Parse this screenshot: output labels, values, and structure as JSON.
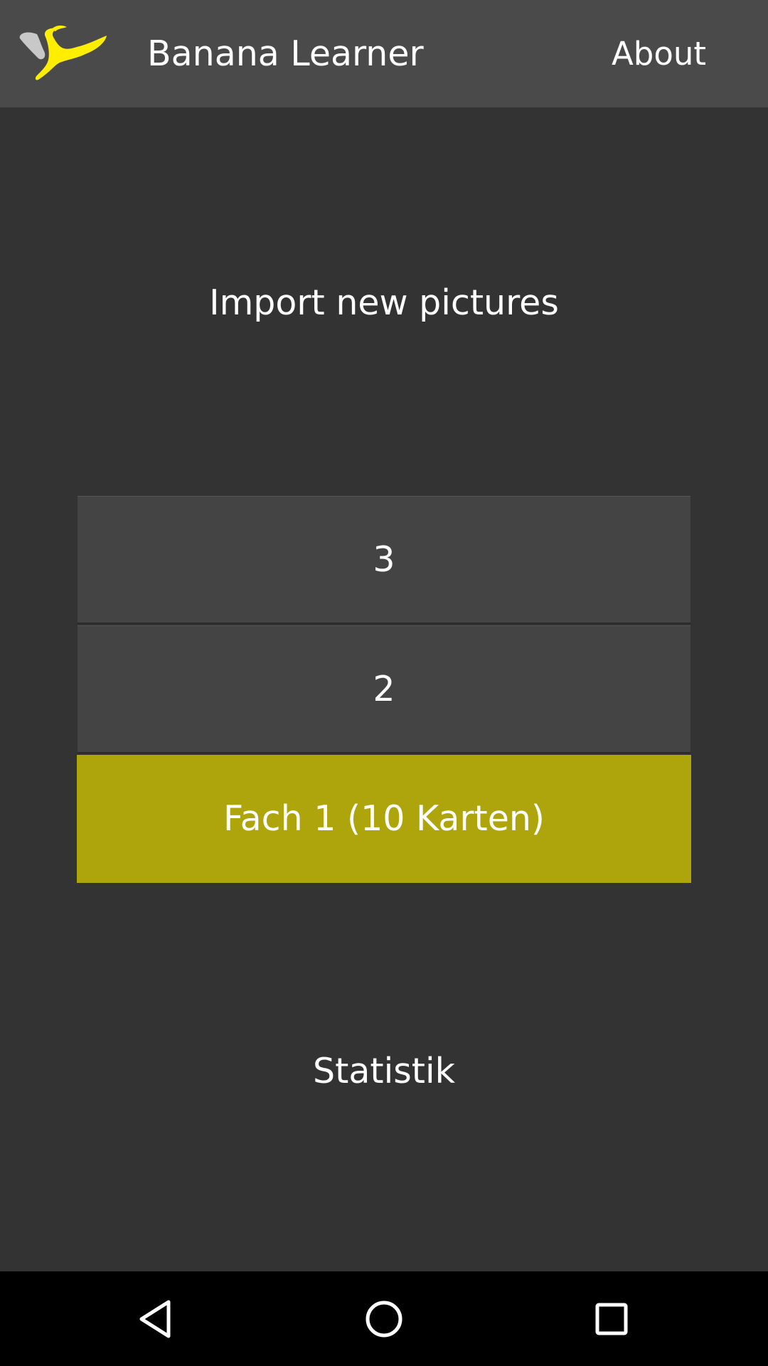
{
  "action_bar": {
    "title": "Banana Learner",
    "about_label": "About",
    "logo_icon": "banana-logo-icon",
    "background": "#4a4a4a"
  },
  "main": {
    "import_label": "Import new pictures",
    "boxes": [
      {
        "label": "3",
        "selected": false
      },
      {
        "label": "2",
        "selected": false
      },
      {
        "label": "Fach 1  (10 Karten)",
        "selected": true
      }
    ],
    "statistics_label": "Statistik",
    "accent_color": "#aea40b",
    "box_color": "#444444"
  },
  "nav_bar": {
    "back_icon": "back-triangle-icon",
    "home_icon": "home-circle-icon",
    "recents_icon": "recents-square-icon"
  }
}
